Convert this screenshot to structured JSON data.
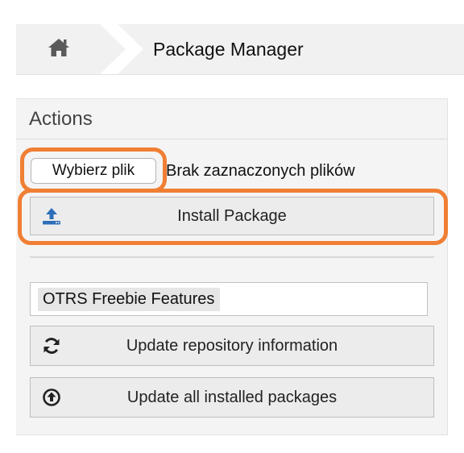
{
  "breadcrumb": {
    "home_icon": "home-icon",
    "title": "Package Manager"
  },
  "actions": {
    "header": "Actions",
    "file_input": {
      "button_label": "Wybierz plik",
      "status": "Brak zaznaczonych plików"
    },
    "install_button": {
      "label": "Install Package",
      "icon": "upload-icon"
    },
    "repository_select": {
      "value": "OTRS Freebie Features"
    },
    "update_repo_button": {
      "label": "Update repository information",
      "icon": "refresh-icon"
    },
    "update_all_button": {
      "label": "Update all installed packages",
      "icon": "circle-arrow-up-icon"
    }
  },
  "colors": {
    "highlight": "#f07f34",
    "button_bg": "#ececec",
    "panel_bg": "#f4f4f4"
  }
}
